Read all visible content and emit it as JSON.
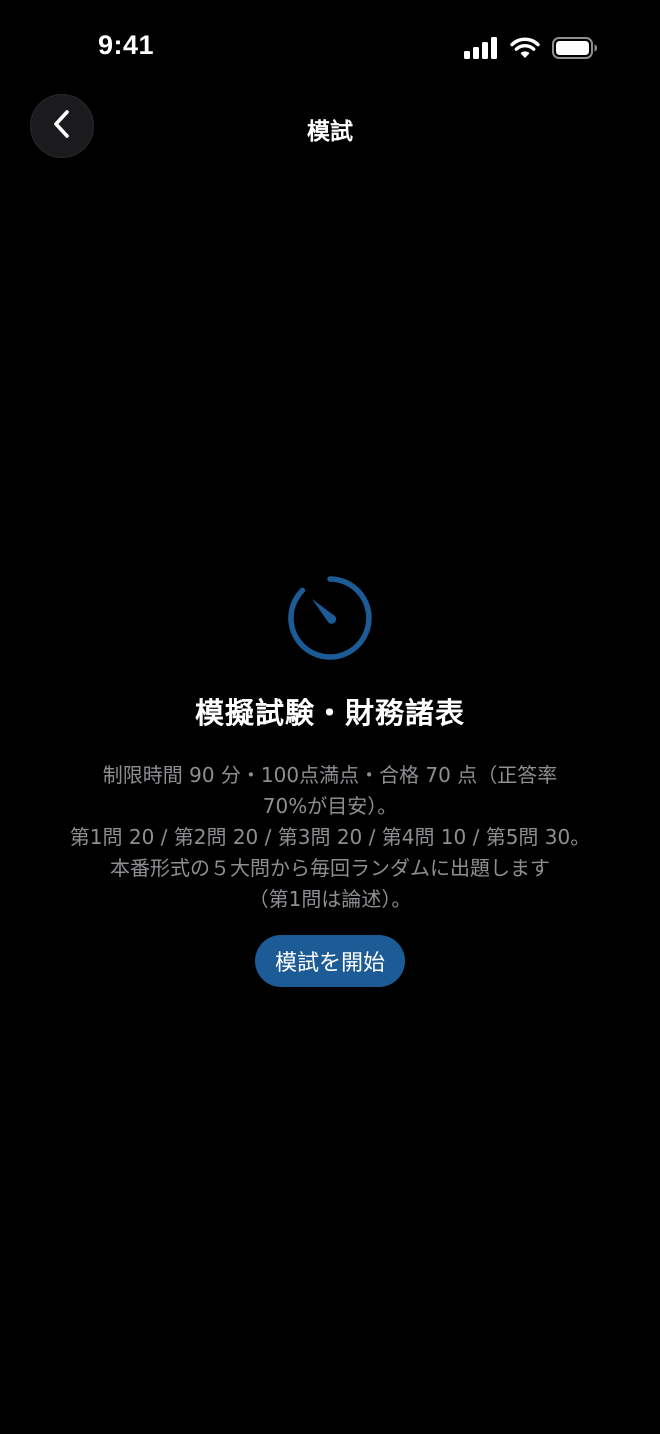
{
  "status_bar": {
    "time": "9:41"
  },
  "nav": {
    "title": "模試",
    "back_icon": "chevron-left-icon"
  },
  "exam": {
    "icon": "timer-icon",
    "accent_color": "#1c5b96",
    "title": "模擬試験・財務諸表",
    "description_lines": [
      "制限時間 90 分・100点満点・合格 70 点（正答率",
      "70%が目安）。",
      "第1問 20 / 第2問 20 / 第3問 20 / 第4問 10 / 第5問 30。",
      "本番形式の５大問から毎回ランダムに出題します",
      "（第1問は論述）。"
    ],
    "start_label": "模試を開始"
  }
}
